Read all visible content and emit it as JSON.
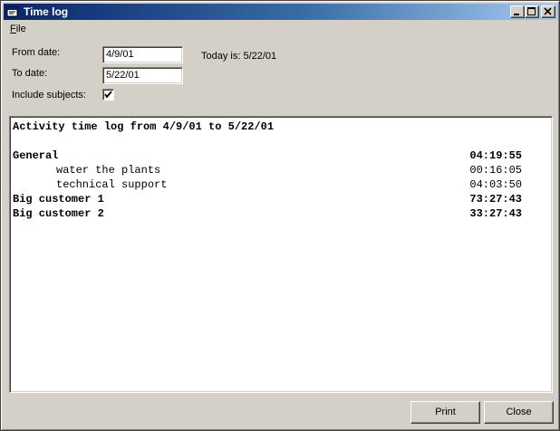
{
  "window": {
    "title": "Time log",
    "icon": "app-icon",
    "title_bar_color": "#0a246a"
  },
  "menu": {
    "items": [
      {
        "label": "File"
      }
    ]
  },
  "form": {
    "from_label": "From date:",
    "from_value": "4/9/01",
    "to_label": "To date:",
    "to_value": "5/22/01",
    "today_text": "Today is: 5/22/01",
    "subjects_label": "Include subjects:",
    "subjects_checked": true
  },
  "report": {
    "heading": "Activity time log from 4/9/01 to 5/22/01",
    "rows": [
      {
        "name": "General",
        "time": "04:19:55",
        "bold": true,
        "indent": false
      },
      {
        "name": "water the plants",
        "time": "00:16:05",
        "bold": false,
        "indent": true
      },
      {
        "name": "technical support",
        "time": "04:03:50",
        "bold": false,
        "indent": true
      },
      {
        "name": "Big customer 1",
        "time": "73:27:43",
        "bold": true,
        "indent": false
      },
      {
        "name": "Big customer 2",
        "time": "33:27:43",
        "bold": true,
        "indent": false
      }
    ]
  },
  "buttons": {
    "print": "Print",
    "close": "Close"
  }
}
